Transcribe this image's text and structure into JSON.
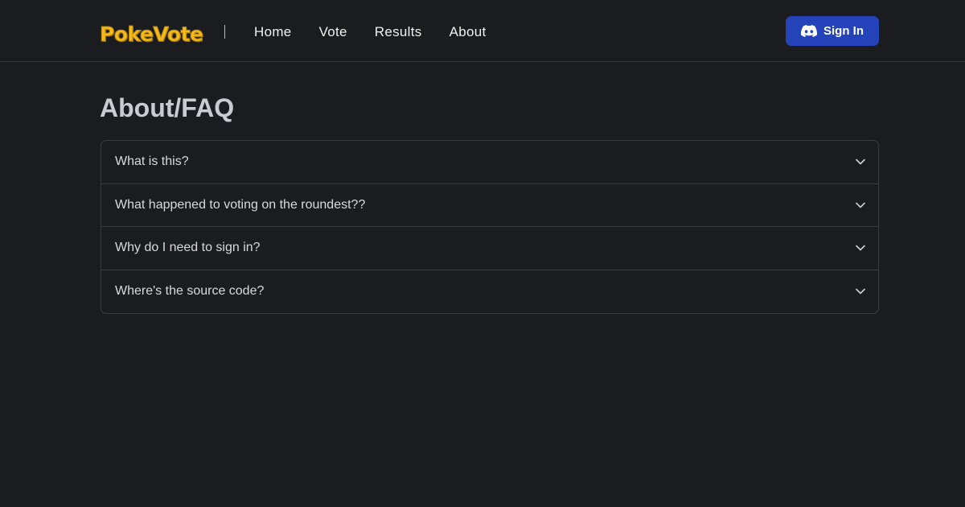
{
  "header": {
    "logo_text": "PokeVote",
    "nav": [
      "Home",
      "Vote",
      "Results",
      "About"
    ],
    "signin_label": "Sign In",
    "signin_icon": "discord-icon"
  },
  "main": {
    "title": "About/FAQ",
    "faq": [
      "What is this?",
      "What happened to voting on the roundest??",
      "Why do I need to sign in?",
      "Where's the source code?"
    ]
  },
  "colors": {
    "background": "#1b1c20",
    "accent_button": "#2543b8",
    "logo": "#f5b91c",
    "border": "#3a3c42"
  }
}
